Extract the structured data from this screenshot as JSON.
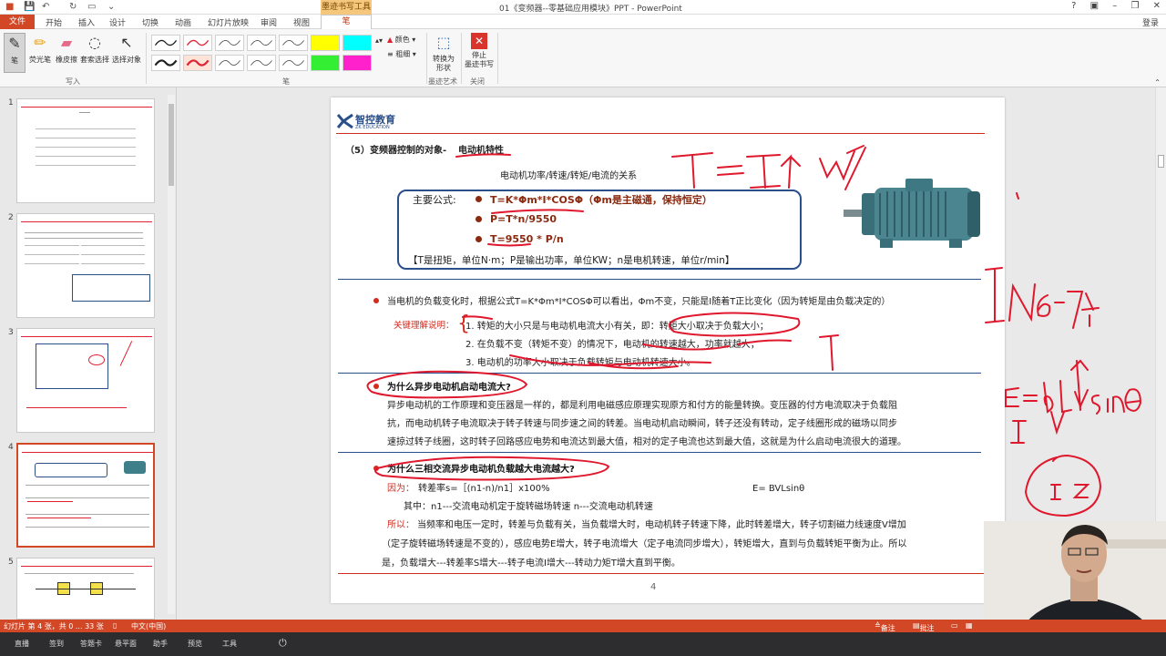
{
  "window": {
    "title": "01《变频器--零基础应用模块》PPT - PowerPoint",
    "context_tab_group": "墨迹书写工具",
    "login": "登录"
  },
  "tabs": [
    "文件",
    "开始",
    "插入",
    "设计",
    "切换",
    "动画",
    "幻灯片放映",
    "审阅",
    "视图",
    "笔"
  ],
  "ribbon": {
    "write_group": {
      "label": "写入",
      "pen": "笔",
      "highlighter": "荧光笔",
      "eraser": "橡皮擦",
      "lasso": "套索选择",
      "select": "选择对象"
    },
    "pens_group_label": "笔",
    "color_label": "颜色",
    "weight_label": "粗细",
    "convert_label": "转换为\n形状",
    "convert_group_label": "墨迹艺术",
    "stop_label": "停止\n墨迹书写",
    "close_group_label": "关闭"
  },
  "thumbnails": [
    "1",
    "2",
    "3",
    "4",
    "5"
  ],
  "selected_thumbnail": "4",
  "slide": {
    "logo_cn": "智控教育",
    "logo_en": "ZK EDUCATION",
    "heading_prefix": "（5）变频器控制的对象-",
    "heading_emph": "电动机特性",
    "subtitle": "电动机功率/转速/转矩/电流的关系",
    "formula_label": "主要公式:",
    "formulas": [
      "T=K*Φm*I*COSΦ（Φm是主磁通，保持恒定）",
      "P=T*n/9550",
      "T=9550 * P/n"
    ],
    "formula_note": "【T是扭矩，单位N·m；P是输出功率，单位KW；n是电机转速，单位r/min】",
    "para1": "当电机的负载变化时，根据公式T=K*Φm*I*COSΦ可以看出，Φm不变，只能是I随着T正比变化（因为转矩是由负载决定的）",
    "key_label": "关键理解说明：",
    "key_points": [
      "1. 转矩的大小只是与电动机电流大小有关，即：转矩大小取决于负载大小；",
      "2. 在负载不变（转矩不变）的情况下，电动机的转速越大，功率就越大；",
      "3. 电动机的功率大小取决于负载转矩与电动机转速大小。"
    ],
    "q1": "为什么异步电动机启动电流大?",
    "q1_body": [
      "异步电动机的工作原理和变压器是一样的，都是利用电磁感应原理实现原方和付方的能量转换。变压器的付方电流取决于负载阻",
      "抗，而电动机转子电流取决于转子转速与同步速之间的转差。当电动机启动瞬间，转子还没有转动，定子线圈形成的磁场以同步",
      "速掠过转子线圈，这时转子回路感应电势和电流达到最大值，相对的定子电流也达到最大值，这就是为什么启动电流很大的道理。"
    ],
    "q2": "为什么三相交流异步电动机负载越大电流越大?",
    "because_label": "因为：",
    "because_text": "转差率s=［(n1-n)/n1］x100%",
    "ev_formula": "E= BVLsinθ",
    "where_text": "其中：n1---交流电动机定于旋转磁场转速 n---交流电动机转速",
    "so_label": "所以：",
    "so_lines": [
      "当频率和电压一定时，转差与负载有关，当负载增大时，电动机转子转速下降，此时转差增大，转子切割磁力线速度V增加",
      "（定子旋转磁场转速是不变的），感应电势E增大，转子电流增大（定子电流同步增大），转矩增大，直到与负载转矩平衡为止。所以",
      "是，负载增大---转差率S增大---转子电流I增大---转动力矩T增大直到平衡。"
    ],
    "page_number": "4",
    "handwriting": [
      "T=I↑ W",
      "I N6-7倍",
      "E=bLVsinθ",
      "I",
      "I₂Z"
    ]
  },
  "statusbar": {
    "slide_info": "幻灯片 第 4 张，共 0 ... 33 张",
    "language": "中文(中国)",
    "notes": "备注",
    "comments": "批注"
  },
  "taskbar": [
    "直播",
    "签到",
    "答题卡",
    "悬平面",
    "助手",
    "预览",
    "工具"
  ],
  "colors": {
    "accent": "#d24726",
    "slide_red": "#d32b1e",
    "slide_blue": "#2b4f8a",
    "ink_red": "#e0182d"
  }
}
